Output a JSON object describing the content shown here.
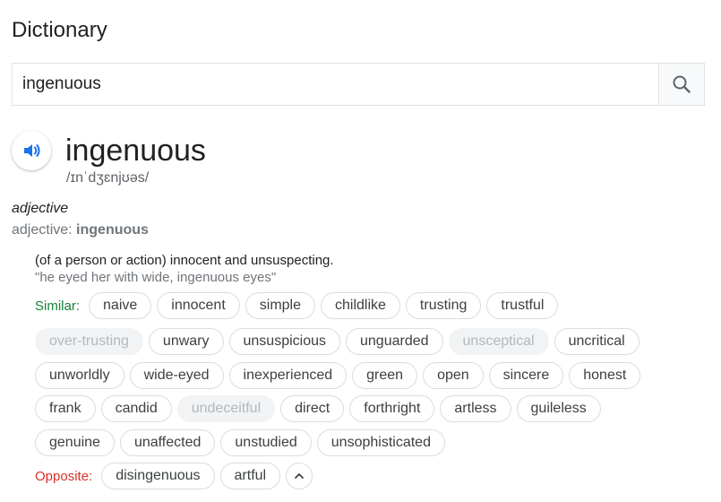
{
  "header": {
    "title": "Dictionary"
  },
  "search": {
    "value": "ingenuous",
    "icon": "search-icon"
  },
  "entry": {
    "word": "ingenuous",
    "phonetic": "/ɪnˈdʒɛnjʊəs/",
    "audio_icon": "speaker-icon",
    "part_of_speech": "adjective",
    "pos_prefix": "adjective: ",
    "pos_word": "ingenuous",
    "definition": "(of a person or action) innocent and unsuspecting.",
    "example": "\"he eyed her with wide, ingenuous eyes\""
  },
  "similar": {
    "label": "Similar:",
    "rows": [
      [
        {
          "text": "naive"
        },
        {
          "text": "innocent"
        },
        {
          "text": "simple"
        },
        {
          "text": "childlike"
        },
        {
          "text": "trusting"
        },
        {
          "text": "trustful"
        }
      ],
      [
        {
          "text": "over-trusting",
          "dim": true
        },
        {
          "text": "unwary"
        },
        {
          "text": "unsuspicious"
        },
        {
          "text": "unguarded"
        },
        {
          "text": "unsceptical",
          "dim": true
        },
        {
          "text": "uncritical"
        }
      ],
      [
        {
          "text": "unworldly"
        },
        {
          "text": "wide-eyed"
        },
        {
          "text": "inexperienced"
        },
        {
          "text": "green"
        },
        {
          "text": "open"
        },
        {
          "text": "sincere"
        },
        {
          "text": "honest"
        }
      ],
      [
        {
          "text": "frank"
        },
        {
          "text": "candid"
        },
        {
          "text": "undeceitful",
          "dim": true
        },
        {
          "text": "direct"
        },
        {
          "text": "forthright"
        },
        {
          "text": "artless"
        },
        {
          "text": "guileless"
        }
      ],
      [
        {
          "text": "genuine"
        },
        {
          "text": "unaffected"
        },
        {
          "text": "unstudied"
        },
        {
          "text": "unsophisticated"
        }
      ]
    ]
  },
  "opposite": {
    "label": "Opposite:",
    "items": [
      {
        "text": "disingenuous"
      },
      {
        "text": "artful"
      }
    ],
    "collapse_icon": "chevron-up-icon"
  },
  "colors": {
    "similar": "#188038",
    "opposite": "#d93025",
    "accent": "#1a73e8"
  }
}
